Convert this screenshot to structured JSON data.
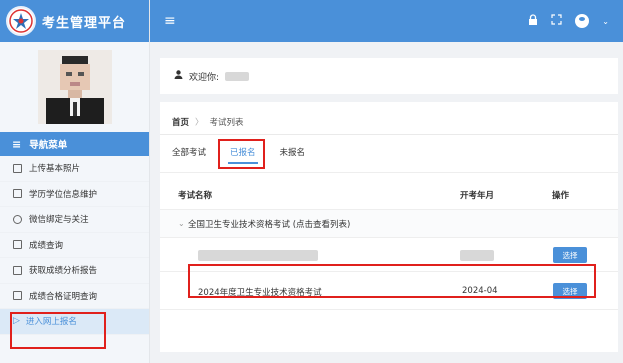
{
  "app": {
    "title": "考生管理平台"
  },
  "sidebar": {
    "nav_title": "导航菜单",
    "items": [
      {
        "label": "上传基本照片",
        "icon": "image-icon"
      },
      {
        "label": "学历学位信息维护",
        "icon": "card-icon"
      },
      {
        "label": "微信绑定与关注",
        "icon": "wechat-icon"
      },
      {
        "label": "成绩查询",
        "icon": "document-icon"
      },
      {
        "label": "获取成绩分析报告",
        "icon": "report-icon"
      },
      {
        "label": "成绩合格证明查询",
        "icon": "certificate-icon"
      },
      {
        "label": "进入网上报名",
        "icon": "send-icon",
        "active": true
      }
    ]
  },
  "topbar": {
    "icons": [
      "menu-icon",
      "lock-icon",
      "fullscreen-icon",
      "user-icon",
      "chevron-down-icon"
    ]
  },
  "welcome": {
    "label": "欢迎你:"
  },
  "breadcrumb": {
    "home": "首页",
    "separator": "〉",
    "current": "考试列表"
  },
  "tabs": [
    {
      "label": "全部考试"
    },
    {
      "label": "已报名",
      "selected": true
    },
    {
      "label": "未报名"
    }
  ],
  "table": {
    "headers": {
      "name": "考试名称",
      "date": "开考年月",
      "op": "操作"
    },
    "group": {
      "label": "全国卫生专业技术资格考试 (点击查看列表)"
    },
    "rows": [
      {
        "name": "",
        "date": "",
        "action": "选择"
      },
      {
        "name": "2024年度卫生专业技术资格考试",
        "date": "2024-04",
        "action": "选择"
      }
    ]
  },
  "colors": {
    "primary": "#4a90d9",
    "highlight": "#e0201c"
  }
}
